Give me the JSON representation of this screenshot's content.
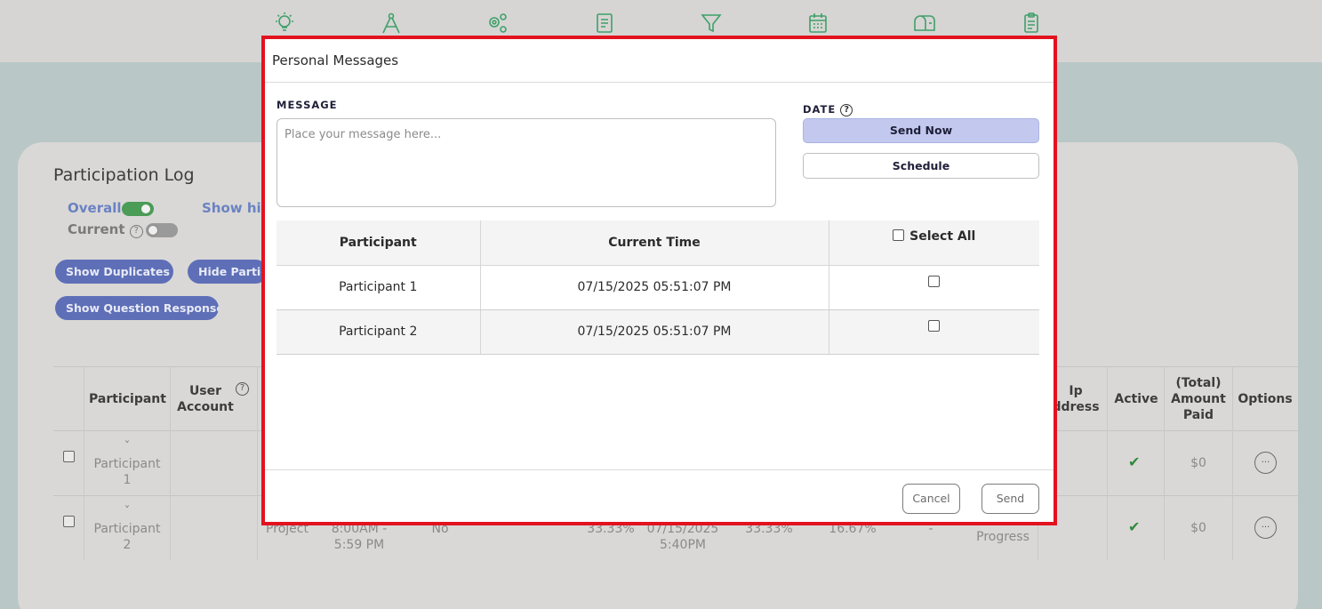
{
  "colors": {
    "accent_green": "#2f8a3a",
    "highlight_border": "#e3121f",
    "send_now_bg": "#c3c9ee",
    "pill_bg": "#5e6fb8"
  },
  "top_icons": [
    "lightbulb-icon",
    "compass-icon",
    "gears-icon",
    "document-icon",
    "filter-icon",
    "calendar-icon",
    "mailbox-icon",
    "clipboard-icon"
  ],
  "background": {
    "title": "Participation Log",
    "overall_label": "Overall",
    "show_hidden_label": "Show hic",
    "current_label": "Current",
    "help_glyph": "?",
    "buttons": {
      "show_duplicates": "Show Duplicates",
      "hide_participants": "Hide Partic",
      "show_question_response": "Show Question Response"
    },
    "table": {
      "headers": {
        "participant": "Participant",
        "user_account": "User Account",
        "ip_address": "Ip ddress",
        "active": "Active",
        "total_amount_paid": "(Total) Amount Paid",
        "options": "Options"
      },
      "rows": [
        {
          "chevron": "ˇ",
          "participant": "Participant 1",
          "amount": "$0",
          "options": "..."
        },
        {
          "chevron": "ˇ",
          "participant": "Participant 2",
          "amount": "$0",
          "options": "...",
          "project": "Project",
          "schedule": "8:00AM - 5:59 PM",
          "no": "No",
          "pct1": "33.33%",
          "date": "07/15/2025 5:40PM",
          "pct2": "33.33%",
          "pct3": "16.67%",
          "dash": "-",
          "status": "Progress"
        }
      ],
      "active_check": "✔"
    }
  },
  "modal": {
    "title": "Personal Messages",
    "message_label": "MESSAGE",
    "message_placeholder": "Place your message here...",
    "message_value": "",
    "date_label": "DATE",
    "date_help": "?",
    "send_now_label": "Send Now",
    "schedule_label": "Schedule",
    "table": {
      "headers": [
        "Participant",
        "Current Time",
        "Select All"
      ],
      "rows": [
        {
          "participant": "Participant 1",
          "time": "07/15/2025 05:51:07 PM",
          "selected": false
        },
        {
          "participant": "Participant 2",
          "time": "07/15/2025 05:51:07 PM",
          "selected": false
        }
      ]
    },
    "cancel_label": "Cancel",
    "send_label": "Send"
  }
}
